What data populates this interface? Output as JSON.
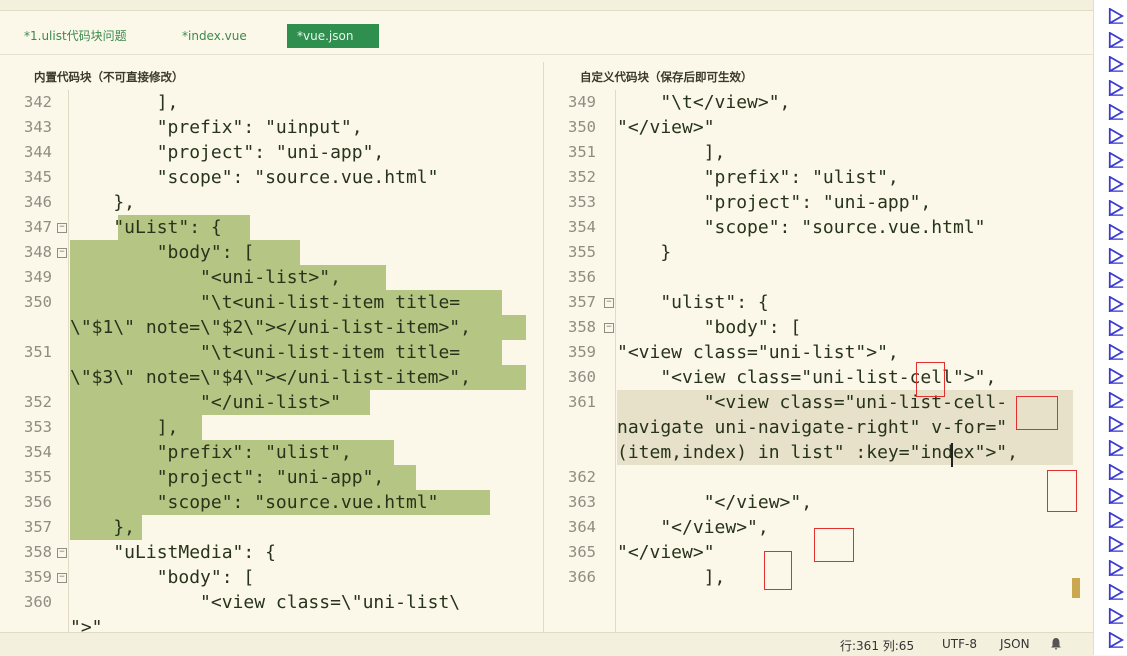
{
  "tabs": [
    {
      "label": "*1.ulist代码块问题"
    },
    {
      "label": "*index.vue"
    },
    {
      "label": "*vue.json"
    }
  ],
  "left_pane": {
    "title": "内置代码块（不可直接修改）",
    "lines": [
      {
        "n": "342",
        "text": "        ],"
      },
      {
        "n": "343",
        "text": "        \"prefix\": \"uinput\","
      },
      {
        "n": "344",
        "text": "        \"project\": \"uni-app\","
      },
      {
        "n": "345",
        "text": "        \"scope\": \"source.vue.html\""
      },
      {
        "n": "346",
        "text": "    },"
      },
      {
        "n": "347",
        "text": "    \"uList\": {"
      },
      {
        "n": "348",
        "text": "        \"body\": ["
      },
      {
        "n": "349",
        "text": "            \"<uni-list>\","
      },
      {
        "n": "350",
        "text": "            \"\\t<uni-list-item title="
      },
      {
        "n": "",
        "text": "\\\"$1\\\" note=\\\"$2\\\"></uni-list-item>\","
      },
      {
        "n": "351",
        "text": "            \"\\t<uni-list-item title="
      },
      {
        "n": "",
        "text": "\\\"$3\\\" note=\\\"$4\\\"></uni-list-item>\","
      },
      {
        "n": "352",
        "text": "            \"</uni-list>\""
      },
      {
        "n": "353",
        "text": "        ],"
      },
      {
        "n": "354",
        "text": "        \"prefix\": \"ulist\","
      },
      {
        "n": "355",
        "text": "        \"project\": \"uni-app\","
      },
      {
        "n": "356",
        "text": "        \"scope\": \"source.vue.html\""
      },
      {
        "n": "357",
        "text": "    },"
      },
      {
        "n": "358",
        "text": "    \"uListMedia\": {"
      },
      {
        "n": "359",
        "text": "        \"body\": ["
      },
      {
        "n": "360",
        "text": "            \"<view class=\\\"uni-list\\"
      },
      {
        "n": "",
        "text": "\">\""
      }
    ]
  },
  "right_pane": {
    "title": "自定义代码块（保存后即可生效）",
    "lines": [
      {
        "n": "349",
        "text": "    \"\\t</view>\","
      },
      {
        "n": "350",
        "text": "\"</view>\""
      },
      {
        "n": "351",
        "text": "        ],"
      },
      {
        "n": "352",
        "text": "        \"prefix\": \"ulist\","
      },
      {
        "n": "353",
        "text": "        \"project\": \"uni-app\","
      },
      {
        "n": "354",
        "text": "        \"scope\": \"source.vue.html\""
      },
      {
        "n": "355",
        "text": "    }"
      },
      {
        "n": "356",
        "text": ""
      },
      {
        "n": "357",
        "text": "    \"ulist\": {"
      },
      {
        "n": "358",
        "text": "        \"body\": ["
      },
      {
        "n": "359",
        "text": "\"<view class=\"uni-list\">\","
      },
      {
        "n": "360",
        "text": "    \"<view class=\"uni-list-cell\">\","
      },
      {
        "n": "361",
        "text": "        \"<view class=\"uni-list-cell-"
      },
      {
        "n": "",
        "text": "navigate uni-navigate-right\" v-for=\""
      },
      {
        "n": "",
        "text": "(item,index) in list\" :key=\"index\">\","
      },
      {
        "n": "362",
        "text": ""
      },
      {
        "n": "363",
        "text": "        \"</view>\","
      },
      {
        "n": "364",
        "text": "    \"</view>\","
      },
      {
        "n": "365",
        "text": "\"</view>\""
      },
      {
        "n": "366",
        "text": "        ],"
      }
    ]
  },
  "status_bar": {
    "position": "行:361  列:65",
    "encoding": "UTF-8",
    "language": "JSON"
  },
  "colors": {
    "selection": "#b5c583",
    "active_tab": "#2e8f4e",
    "annotation_box": "#e03030"
  }
}
